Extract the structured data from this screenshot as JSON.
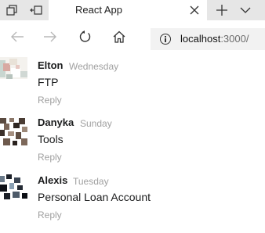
{
  "browser": {
    "tab_title": "React App",
    "url_host": "localhost",
    "url_rest": ":3000/",
    "chrome_bg": "#e6e6e6"
  },
  "comments": [
    {
      "author": "Elton",
      "day": "Wednesday",
      "text": "FTP",
      "reply_label": "Reply",
      "avatar": "avatar-light-pattern"
    },
    {
      "author": "Danyka",
      "day": "Sunday",
      "text": "Tools",
      "reply_label": "Reply",
      "avatar": "avatar-mosaic-pattern"
    },
    {
      "author": "Alexis",
      "day": "Tuesday",
      "text": "Personal Loan Account",
      "reply_label": "Reply",
      "avatar": "avatar-dark-pattern"
    }
  ]
}
